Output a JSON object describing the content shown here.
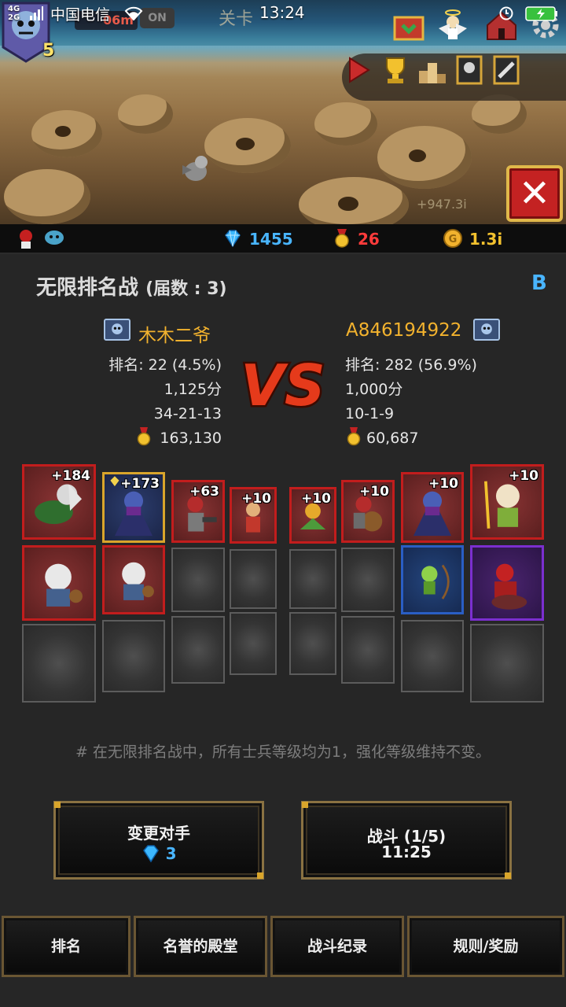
{
  "status_bar": {
    "network": "4G\n2G",
    "carrier": "中国电信",
    "time": "13:24"
  },
  "scene": {
    "player_level": "5",
    "distance": "06m",
    "auto_toggle": "ON",
    "stage_label": "关卡",
    "floating_value": "+947.3i"
  },
  "currency": {
    "gems": "1455",
    "medals": "26",
    "gold": "1.3i"
  },
  "panel": {
    "title": "无限排名战",
    "season": "(届数 : 3)",
    "grade": "B",
    "left_player": {
      "name": "木木二爷",
      "rank": "排名: 22 (4.5%)",
      "score": "1,125分",
      "record": "34-21-13",
      "medals": "163,130",
      "units": [
        {
          "plus": "+184",
          "frame": "red"
        },
        {
          "plus": "+173",
          "frame": "gold"
        },
        {
          "plus": "+63",
          "frame": "red"
        },
        {
          "plus": "+10",
          "frame": "red"
        },
        {
          "plus": "",
          "frame": "red"
        },
        {
          "plus": "",
          "frame": "red"
        }
      ]
    },
    "right_player": {
      "name": "A846194922",
      "rank": "排名: 282 (56.9%)",
      "score": "1,000分",
      "record": "10-1-9",
      "medals": "60,687",
      "units": [
        {
          "plus": "+10",
          "frame": "red"
        },
        {
          "plus": "+10",
          "frame": "red"
        },
        {
          "plus": "+10",
          "frame": "red"
        },
        {
          "plus": "+10",
          "frame": "red"
        },
        {
          "plus": "",
          "frame": "blue"
        },
        {
          "plus": "",
          "frame": "purple"
        }
      ]
    },
    "note": "# 在无限排名战中，所有士兵等级均为1，强化等级维持不变。",
    "change_opponent": {
      "label": "变更对手",
      "cost": "3"
    },
    "battle": {
      "label": "战斗 (1/5)",
      "timer": "11:25"
    },
    "tabs": [
      "排名",
      "名誉的殿堂",
      "战斗纪录",
      "规则/奖励"
    ]
  },
  "colors": {
    "accent_gold": "#f2b22e",
    "frame_red": "#c21d1d",
    "gem_blue": "#49b5ff",
    "medal_red": "#ff3b3b"
  }
}
